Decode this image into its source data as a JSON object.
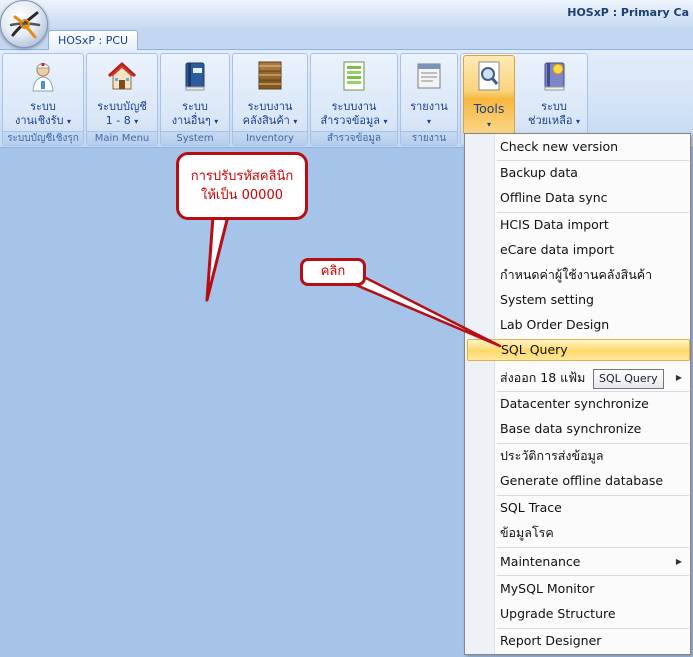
{
  "window": {
    "title": "HOSxP : Primary Ca"
  },
  "tabs": [
    {
      "label": "HOSxP : PCU"
    }
  ],
  "ribbon": {
    "groups": [
      {
        "label": "ระบบบัญชีเชิงรุก",
        "buttons": [
          {
            "line1": "ระบบ",
            "line2": "งานเชิงรับ",
            "icon": "nurse-icon"
          }
        ]
      },
      {
        "label": "Main Menu",
        "buttons": [
          {
            "line1": "ระบบบัญชี",
            "line2": "1 - 8",
            "icon": "home-icon"
          }
        ]
      },
      {
        "label": "System",
        "buttons": [
          {
            "line1": "ระบบ",
            "line2": "งานอื่นๆ",
            "icon": "book-icon"
          }
        ]
      },
      {
        "label": "Inventory",
        "buttons": [
          {
            "line1": "ระบบงาน",
            "line2": "คลังสินค้า",
            "icon": "boxes-icon"
          }
        ]
      },
      {
        "label": "สำรวจข้อมูล",
        "buttons": [
          {
            "line1": "ระบบงาน",
            "line2": "สำรวจข้อมูล",
            "icon": "survey-sheet-icon"
          }
        ]
      },
      {
        "label": "รายงาน",
        "buttons": [
          {
            "line1": "รายงาน",
            "line2": "",
            "icon": "report-icon"
          }
        ]
      },
      {
        "label": "",
        "buttons": [
          {
            "line1": "Tools",
            "line2": "",
            "icon": "tools-magnifier-icon"
          },
          {
            "line1": "ระบบ",
            "line2": "ช่วยเหลือ",
            "icon": "help-book-icon"
          }
        ]
      }
    ],
    "caret": "▾"
  },
  "callouts": {
    "clinic_code": {
      "line1": "การปรับรหัสคลินิก",
      "line2": "ให้เป็น 00000"
    },
    "click": {
      "text": "คลิก"
    }
  },
  "menu": {
    "items": [
      {
        "label": "Check new version"
      },
      {
        "label": "Backup data"
      },
      {
        "label": "Offline Data sync"
      },
      {
        "label": "HCIS Data import"
      },
      {
        "label": "eCare data import"
      },
      {
        "label": "กำหนดค่าผู้ใช้งานคลังสินค้า"
      },
      {
        "label": "System setting"
      },
      {
        "label": "Lab Order Design"
      },
      {
        "label": "SQL Query"
      },
      {
        "label": "ส่งออก 18 แฟ้ม"
      },
      {
        "label": "Datacenter synchronize"
      },
      {
        "label": "Base data synchronize"
      },
      {
        "label": "ประวัติการส่งข้อมูล"
      },
      {
        "label": "Generate offline database"
      },
      {
        "label": "SQL Trace"
      },
      {
        "label": "ข้อมูลโรค"
      },
      {
        "label": "Maintenance"
      },
      {
        "label": "MySQL Monitor"
      },
      {
        "label": "Upgrade Structure"
      },
      {
        "label": "Report Designer"
      }
    ],
    "submenu_arrow": "▶"
  },
  "tooltip": {
    "text": "SQL Query"
  }
}
